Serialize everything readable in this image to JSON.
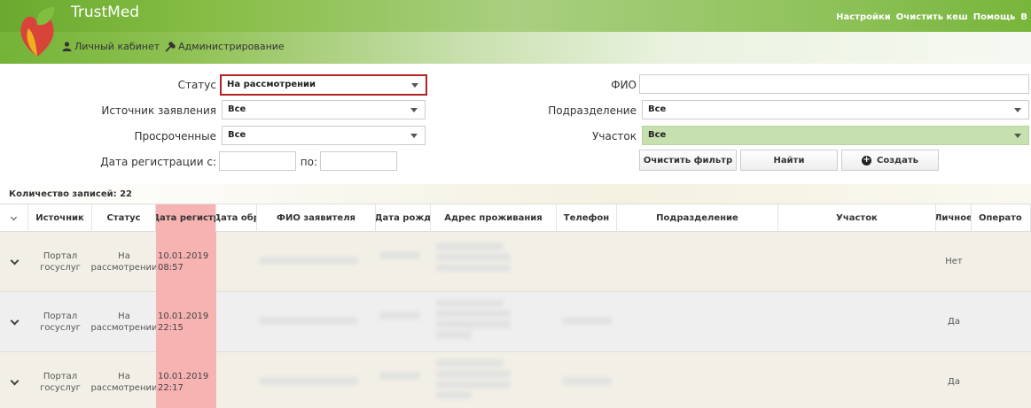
{
  "header": {
    "brand": "TrustMed",
    "nav": [
      {
        "label": "Личный кабинет",
        "icon": "user-icon"
      },
      {
        "label": "Администрирование",
        "icon": "tools-icon"
      }
    ],
    "top_links": [
      "Настройки",
      "Очистить кеш",
      "Помощь",
      "В"
    ]
  },
  "filters": {
    "status_label": "Статус",
    "status_value": "На рассмотрении",
    "source_label": "Источник заявления",
    "source_value": "Все",
    "overdue_label": "Просроченные",
    "overdue_value": "Все",
    "reg_date_label": "Дата регистрации с:",
    "reg_date_to_label": "по:",
    "reg_date_from": "",
    "reg_date_to": "",
    "fio_label": "ФИО",
    "fio_value": "",
    "division_label": "Подразделение",
    "division_value": "Все",
    "area_label": "Участок",
    "area_value": "Все",
    "clear_button": "Очистить фильтр",
    "find_button": "Найти",
    "create_button": "Создать"
  },
  "table": {
    "count_text": "Количество записей: 22",
    "columns": [
      "Источник",
      "Статус",
      "Дата регистр",
      "Дата обр",
      "ФИО заявителя",
      "Дата рожд",
      "Адрес проживания",
      "Телефон",
      "Подразделение",
      "Участок",
      "Личное",
      "Операто"
    ],
    "rows": [
      {
        "source": "Портал госуслуг",
        "status": "На рассмотрении",
        "date": "10.01.2019",
        "time": "08:57",
        "personal": "Нет"
      },
      {
        "source": "Портал госуслуг",
        "status": "На рассмотрении",
        "date": "10.01.2019",
        "time": "22:15",
        "personal": "Да"
      },
      {
        "source": "Портал госуслуг",
        "status": "На рассмотрении",
        "date": "10.01.2019",
        "time": "22:17",
        "personal": "Да"
      }
    ]
  }
}
